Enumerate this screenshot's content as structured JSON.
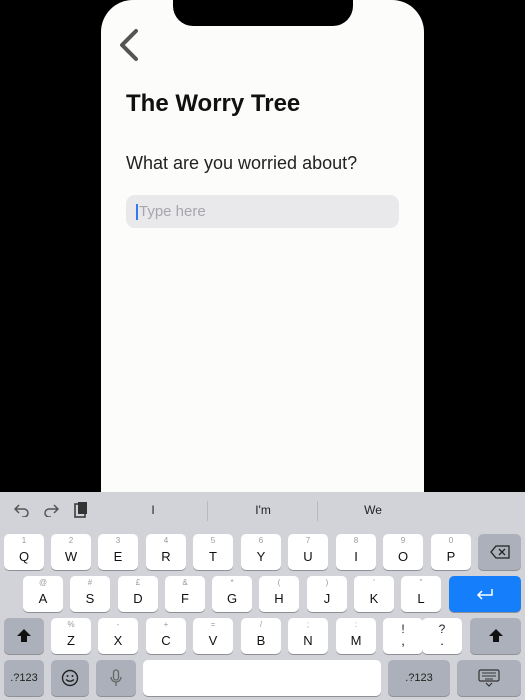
{
  "screen": {
    "title": "The Worry Tree",
    "question": "What are you worried about?",
    "input_placeholder": "Type here"
  },
  "keyboard": {
    "suggestions": [
      "I",
      "I'm",
      "We"
    ],
    "row1": [
      {
        "label": "Q",
        "hint": "1"
      },
      {
        "label": "W",
        "hint": "2"
      },
      {
        "label": "E",
        "hint": "3"
      },
      {
        "label": "R",
        "hint": "4"
      },
      {
        "label": "T",
        "hint": "5"
      },
      {
        "label": "Y",
        "hint": "6"
      },
      {
        "label": "U",
        "hint": "7"
      },
      {
        "label": "I",
        "hint": "8"
      },
      {
        "label": "O",
        "hint": "9"
      },
      {
        "label": "P",
        "hint": "0"
      }
    ],
    "row2": [
      {
        "label": "A",
        "hint": "@"
      },
      {
        "label": "S",
        "hint": "#"
      },
      {
        "label": "D",
        "hint": "£"
      },
      {
        "label": "F",
        "hint": "&"
      },
      {
        "label": "G",
        "hint": "*"
      },
      {
        "label": "H",
        "hint": "("
      },
      {
        "label": "J",
        "hint": ")"
      },
      {
        "label": "K",
        "hint": "'"
      },
      {
        "label": "L",
        "hint": "\""
      }
    ],
    "row3": [
      {
        "label": "Z",
        "hint": "%"
      },
      {
        "label": "X",
        "hint": "-"
      },
      {
        "label": "C",
        "hint": "+"
      },
      {
        "label": "V",
        "hint": "="
      },
      {
        "label": "B",
        "hint": "/"
      },
      {
        "label": "N",
        "hint": ";"
      },
      {
        "label": "M",
        "hint": ":"
      },
      {
        "label": ",",
        "hint": "!"
      },
      {
        "label": ".",
        "hint": "?"
      }
    ],
    "numbers_label": ".?123"
  },
  "colors": {
    "accent": "#157efb",
    "caret": "#3478f6",
    "keyboard_bg": "#d1d3d9"
  },
  "icons": [
    "back-chevron-icon",
    "undo-icon",
    "redo-icon",
    "paste-icon",
    "backspace-icon",
    "return-icon",
    "shift-icon",
    "emoji-icon",
    "mic-icon",
    "hide-keyboard-icon"
  ]
}
